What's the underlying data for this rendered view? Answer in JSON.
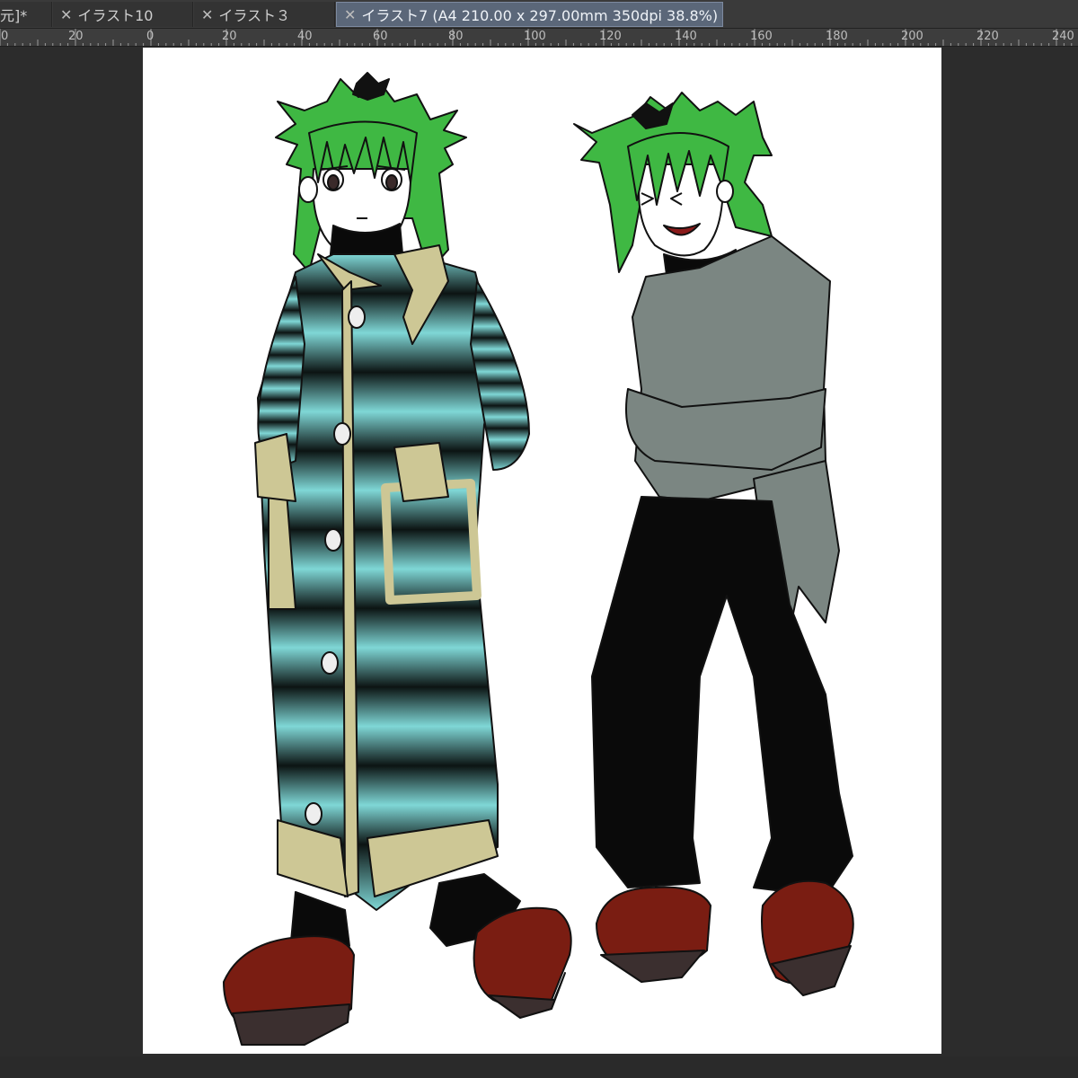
{
  "tabs": [
    {
      "label": "元]*",
      "close": "",
      "active": false
    },
    {
      "label": "イラスト10",
      "close": "✕",
      "active": false
    },
    {
      "label": "イラスト３",
      "close": "✕",
      "active": false
    },
    {
      "label": "イラスト7 (A4 210.00 x 297.00mm 350dpi 38.8%)",
      "close": "✕",
      "active": true
    }
  ],
  "ruler": {
    "labels": [
      "0",
      "20",
      "0",
      "20",
      "40",
      "60",
      "80",
      "100",
      "120",
      "140",
      "160",
      "180",
      "200",
      "220",
      "240"
    ]
  },
  "icons": {
    "close": "close-icon"
  },
  "colors": {
    "tab_active": "#5b6779",
    "hair": "#3fb843",
    "coat_light": "#7fd7d6",
    "coat_trim": "#cdc795",
    "sweater": "#7b8682",
    "boots": "#7a1d12"
  }
}
